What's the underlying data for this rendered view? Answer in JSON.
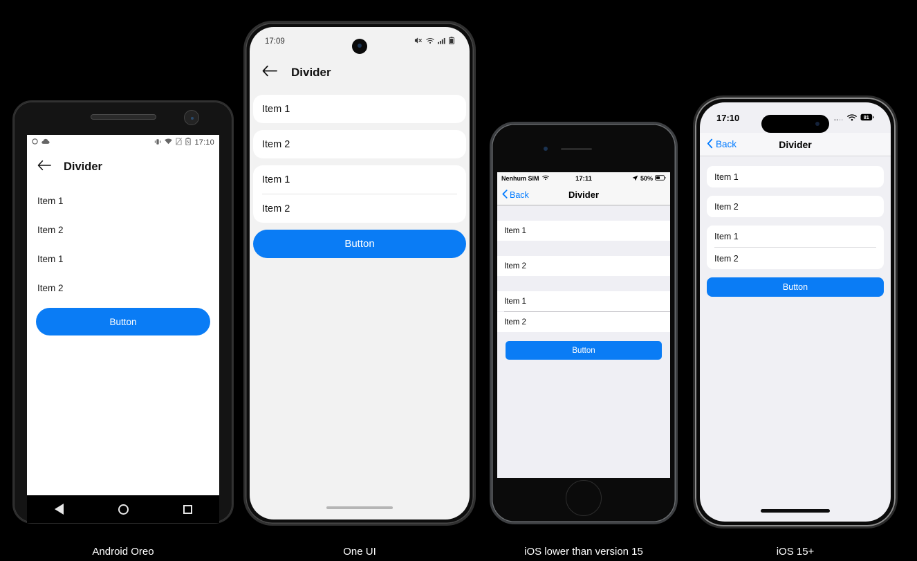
{
  "theme": {
    "accent_blue": "#0a7cf5",
    "ios_blue": "#007aff",
    "page_background": "#000000",
    "caption_color": "#ffffff"
  },
  "devices": [
    {
      "id": "android-oreo",
      "caption": "Android Oreo",
      "status_bar": {
        "time": "17:10",
        "left_icons": [
          "circle-notification-icon",
          "cloud-icon"
        ],
        "right_icons": [
          "vibrate-icon",
          "wifi-icon",
          "no-sim-icon",
          "battery-icon"
        ]
      },
      "app_bar": {
        "back_icon": "arrow-left-icon",
        "title": "Divider"
      },
      "list_items": [
        "Item 1",
        "Item 2",
        "Item 1",
        "Item 2"
      ],
      "button_label": "Button",
      "nav_bar": [
        "triangle-back-icon",
        "circle-home-icon",
        "square-recents-icon"
      ]
    },
    {
      "id": "one-ui",
      "caption": "One UI",
      "status_bar": {
        "time": "17:09",
        "right_icons": [
          "mute-icon",
          "wifi-icon",
          "signal-bars-icon",
          "battery-icon"
        ]
      },
      "app_bar": {
        "back_icon": "arrow-left-icon",
        "title": "Divider"
      },
      "card_groups": [
        {
          "items": [
            "Item 1"
          ],
          "dividers": false
        },
        {
          "items": [
            "Item 2"
          ],
          "dividers": false
        },
        {
          "items": [
            "Item 1",
            "Item 2"
          ],
          "dividers": true
        }
      ],
      "button_label": "Button"
    },
    {
      "id": "ios-lower-than-15",
      "caption": "iOS lower than version 15",
      "status_bar": {
        "carrier": "Nenhum SIM",
        "time": "17:11",
        "battery_percent": "50%",
        "left_icons": [
          "wifi-icon"
        ],
        "right_icons": [
          "location-arrow-icon",
          "battery-icon"
        ]
      },
      "nav_bar": {
        "back_label": "Back",
        "back_icon": "chevron-left-icon",
        "title": "Divider"
      },
      "sections": [
        {
          "items": [
            "Item 1"
          ],
          "dividers": false
        },
        {
          "items": [
            "Item 2"
          ],
          "dividers": false
        },
        {
          "items": [
            "Item 1",
            "Item 2"
          ],
          "dividers": true
        }
      ],
      "button_label": "Button"
    },
    {
      "id": "ios-15-plus",
      "caption": "iOS 15+",
      "status_bar": {
        "time": "17:10",
        "battery_level": "81",
        "right_icons": [
          "cellular-dots-icon",
          "wifi-icon",
          "battery-badge-icon"
        ]
      },
      "nav_bar": {
        "back_label": "Back",
        "back_icon": "chevron-left-icon",
        "title": "Divider"
      },
      "card_groups": [
        {
          "items": [
            "Item 1"
          ],
          "dividers": false
        },
        {
          "items": [
            "Item 2"
          ],
          "dividers": false
        },
        {
          "items": [
            "Item 1",
            "Item 2"
          ],
          "dividers": true
        }
      ],
      "button_label": "Button"
    }
  ]
}
